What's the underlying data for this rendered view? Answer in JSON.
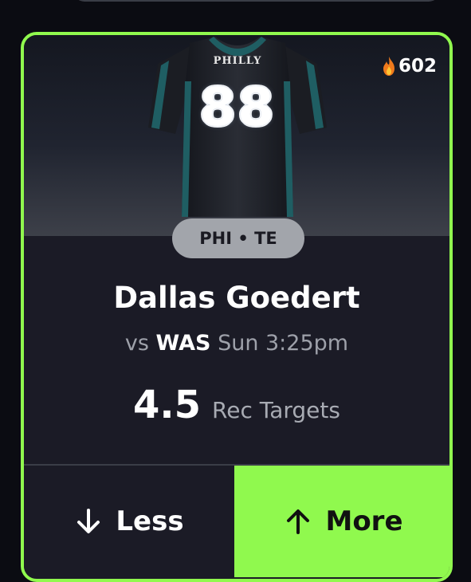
{
  "popularity": {
    "icon": "fire-icon",
    "count": "602"
  },
  "jersey": {
    "team_text": "PHILLY",
    "number": "88",
    "colors": {
      "body": "#1e2128",
      "trim": "#1f5e63"
    }
  },
  "player": {
    "position_tag": "PHI • TE",
    "name": "Dallas Goedert",
    "matchup_prefix": "vs",
    "opponent": "WAS",
    "game_time": "Sun 3:25pm"
  },
  "projection": {
    "line": "4.5",
    "stat": "Rec Targets"
  },
  "actions": {
    "less_label": "Less",
    "less_icon": "arrow-down-icon",
    "more_label": "More",
    "more_icon": "arrow-up-icon"
  },
  "colors": {
    "accent": "#90f94e",
    "card_bg": "#1b1b26",
    "pill_bg": "#a2a5ab"
  }
}
